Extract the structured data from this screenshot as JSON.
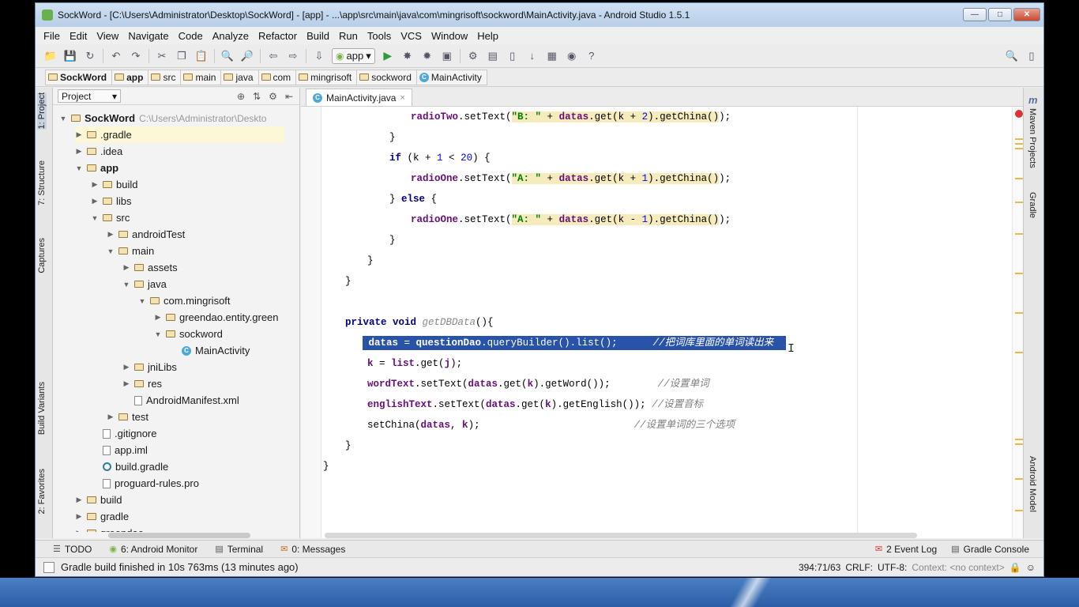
{
  "window": {
    "title": "SockWord - [C:\\Users\\Administrator\\Desktop\\SockWord] - [app] - ...\\app\\src\\main\\java\\com\\mingrisoft\\sockword\\MainActivity.java - Android Studio 1.5.1",
    "controls": [
      "minimize",
      "maximize",
      "close"
    ]
  },
  "menu": [
    "File",
    "Edit",
    "View",
    "Navigate",
    "Code",
    "Analyze",
    "Refactor",
    "Build",
    "Run",
    "Tools",
    "VCS",
    "Window",
    "Help"
  ],
  "toolbar": {
    "run_config": "app",
    "help_glyph": "?"
  },
  "breadcrumb": [
    "SockWord",
    "app",
    "src",
    "main",
    "java",
    "com",
    "mingrisoft",
    "sockword",
    "MainActivity"
  ],
  "left_tabs": [
    "1: Project",
    "7: Structure",
    "Captures",
    "Build Variants",
    "2: Favorites"
  ],
  "right_tabs": [
    "Maven Projects",
    "Gradle",
    "Android Model"
  ],
  "project_panel": {
    "view_selector": "Project",
    "tree": [
      {
        "label": "SockWord",
        "extra": "C:\\Users\\Administrator\\Deskto",
        "depth": 0,
        "expanded": true,
        "kind": "project"
      },
      {
        "label": ".gradle",
        "depth": 1,
        "expanded": false,
        "kind": "folder",
        "highlight": true
      },
      {
        "label": ".idea",
        "depth": 1,
        "expanded": false,
        "kind": "folder"
      },
      {
        "label": "app",
        "depth": 1,
        "expanded": true,
        "kind": "module"
      },
      {
        "label": "build",
        "depth": 2,
        "expanded": false,
        "kind": "folder"
      },
      {
        "label": "libs",
        "depth": 2,
        "expanded": false,
        "kind": "folder"
      },
      {
        "label": "src",
        "depth": 2,
        "expanded": true,
        "kind": "folder"
      },
      {
        "label": "androidTest",
        "depth": 3,
        "expanded": false,
        "kind": "folder"
      },
      {
        "label": "main",
        "depth": 3,
        "expanded": true,
        "kind": "folder"
      },
      {
        "label": "assets",
        "depth": 4,
        "expanded": false,
        "kind": "folder"
      },
      {
        "label": "java",
        "depth": 4,
        "expanded": true,
        "kind": "folder"
      },
      {
        "label": "com.mingrisoft",
        "depth": 5,
        "expanded": true,
        "kind": "package"
      },
      {
        "label": "greendao.entity.green",
        "depth": 6,
        "expanded": false,
        "kind": "package"
      },
      {
        "label": "sockword",
        "depth": 6,
        "expanded": true,
        "kind": "package"
      },
      {
        "label": "MainActivity",
        "depth": 7,
        "expanded": null,
        "kind": "class"
      },
      {
        "label": "jniLibs",
        "depth": 4,
        "expanded": false,
        "kind": "folder"
      },
      {
        "label": "res",
        "depth": 4,
        "expanded": false,
        "kind": "folder"
      },
      {
        "label": "AndroidManifest.xml",
        "depth": 4,
        "expanded": null,
        "kind": "file"
      },
      {
        "label": "test",
        "depth": 3,
        "expanded": false,
        "kind": "folder"
      },
      {
        "label": ".gitignore",
        "depth": 2,
        "expanded": null,
        "kind": "file"
      },
      {
        "label": "app.iml",
        "depth": 2,
        "expanded": null,
        "kind": "file"
      },
      {
        "label": "build.gradle",
        "depth": 2,
        "expanded": null,
        "kind": "gradle"
      },
      {
        "label": "proguard-rules.pro",
        "depth": 2,
        "expanded": null,
        "kind": "file"
      },
      {
        "label": "build",
        "depth": 1,
        "expanded": false,
        "kind": "folder"
      },
      {
        "label": "gradle",
        "depth": 1,
        "expanded": false,
        "kind": "folder"
      },
      {
        "label": "greendao",
        "depth": 1,
        "expanded": false,
        "kind": "folder"
      }
    ]
  },
  "editor": {
    "tab_label": "MainActivity.java",
    "close_glyph": "×"
  },
  "bottom_tabs": {
    "left": [
      {
        "icon": "todo-icon",
        "label": "TODO"
      },
      {
        "icon": "android-monitor-icon",
        "label": "6: Android Monitor"
      },
      {
        "icon": "terminal-icon",
        "label": "Terminal"
      },
      {
        "icon": "messages-icon",
        "label": "0: Messages"
      }
    ],
    "right": [
      {
        "icon": "event-log-icon",
        "label": "2 Event Log"
      },
      {
        "icon": "gradle-console-icon",
        "label": "Gradle Console"
      }
    ]
  },
  "status": {
    "message": "Gradle build finished in 10s 763ms (13 minutes ago)",
    "position": "394:71/63",
    "line_sep": "CRLF:",
    "encoding": "UTF-8:",
    "context": "Context: <no context>"
  },
  "colors": {
    "selection": "#2953a8",
    "warning_bg": "#f6ebbc",
    "keyword": "#000080",
    "field": "#660e7a",
    "string": "#008000",
    "comment": "#808080"
  }
}
